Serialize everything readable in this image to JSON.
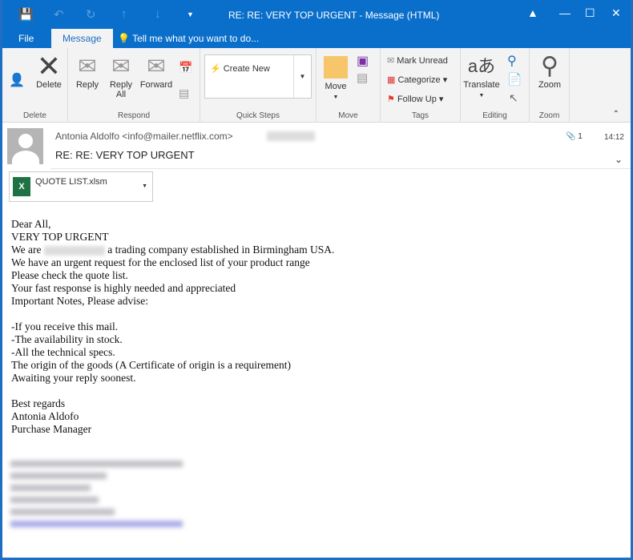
{
  "window": {
    "title": "RE: RE: VERY TOP URGENT - Message (HTML)"
  },
  "tabs": [
    {
      "label": "File"
    },
    {
      "label": "Message"
    }
  ],
  "tell_me": "Tell me what you want to do...",
  "ribbon": {
    "delete": {
      "delete": "Delete",
      "group": "Delete"
    },
    "respond": {
      "reply": "Reply",
      "reply_all_1": "Reply",
      "reply_all_2": "All",
      "forward": "Forward",
      "group": "Respond"
    },
    "quick_steps": {
      "create_new": "Create New",
      "group": "Quick Steps"
    },
    "move": {
      "move": "Move",
      "group": "Move"
    },
    "tags": {
      "mark_unread": "Mark Unread",
      "categorize": "Categorize",
      "follow_up": "Follow Up",
      "group": "Tags"
    },
    "editing": {
      "translate": "Translate",
      "group": "Editing"
    },
    "zoom": {
      "zoom": "Zoom",
      "group": "Zoom"
    }
  },
  "message": {
    "from": "Antonia Aldolfo <info@mailer.netflix.com>",
    "subject": "RE: RE: VERY TOP URGENT",
    "time": "14:12",
    "attachment_count": "1",
    "attachment": "QUOTE LIST.xlsm",
    "body": {
      "l1": "Dear All,",
      "l2": "VERY TOP URGENT",
      "l3a": "We are",
      "l3b": "a trading company established in Birmingham USA.",
      "l4": "We have an urgent request for the enclosed list of your product range",
      "l5": "Please check the quote list.",
      "l6": "Your fast response is highly needed and appreciated",
      "l7": "Important Notes, Please advise:",
      "l9": "-If you receive this mail.",
      "l10": "-The availability in stock.",
      "l11": "-All the technical specs.",
      "l12": "The origin of the goods (A Certificate of origin is a requirement)",
      "l13": "Awaiting your reply soonest.",
      "l15": "Best regards",
      "l16": "Antonia Aldofo",
      "l17": "Purchase Manager"
    }
  },
  "colors": {
    "accent": "#0a6fcb"
  }
}
